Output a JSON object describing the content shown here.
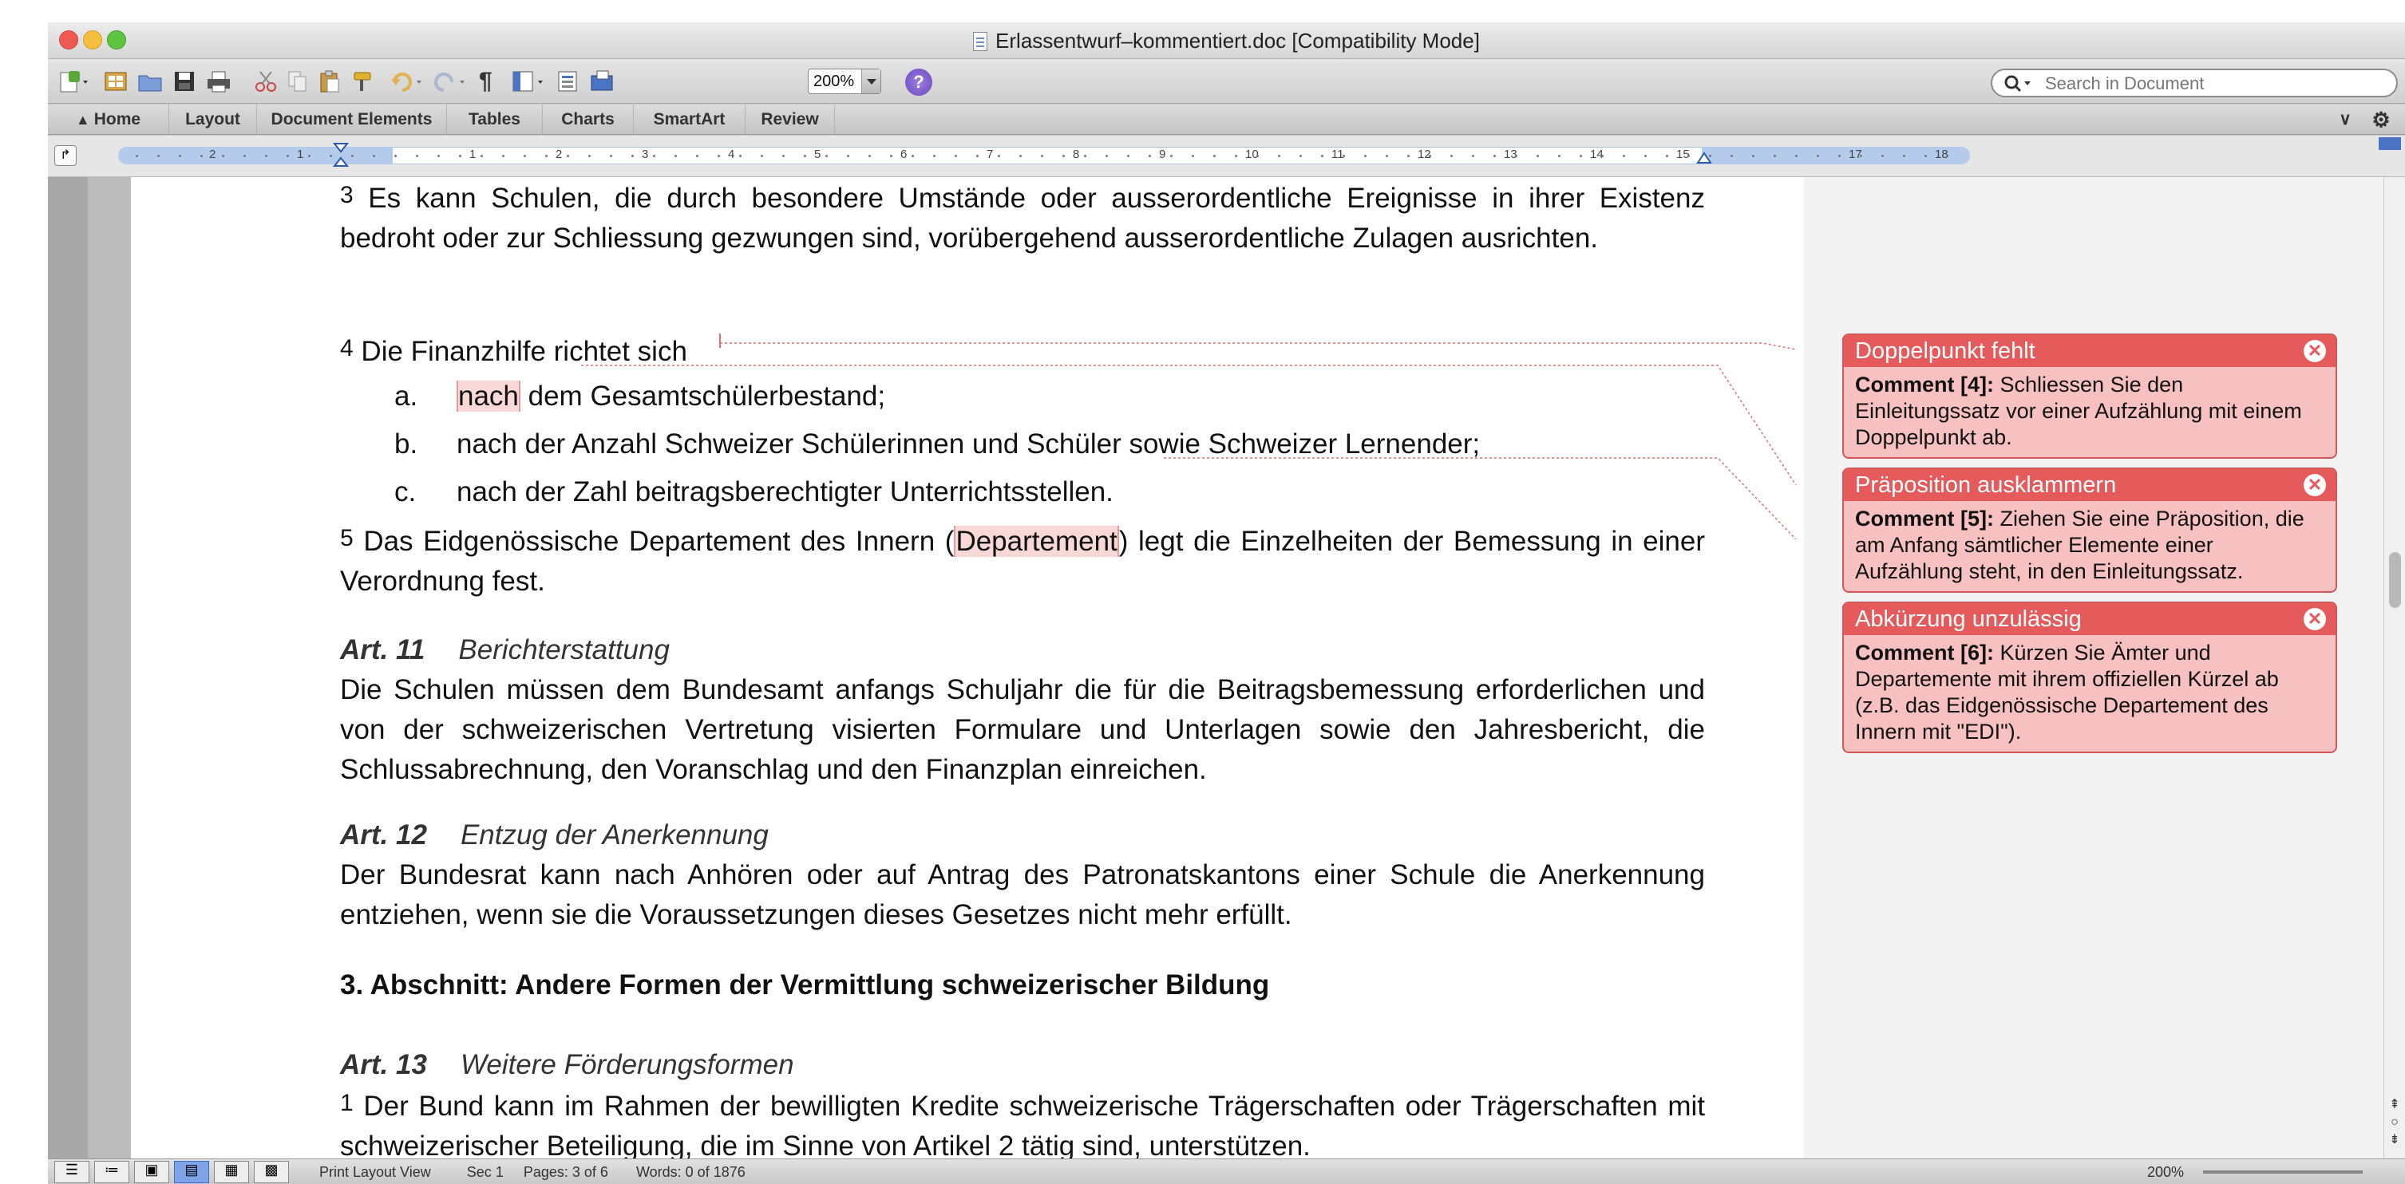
{
  "window": {
    "title": "Erlassentwurf–kommentiert.doc [Compatibility Mode]"
  },
  "toolbar": {
    "zoom": "200%",
    "help": "?",
    "search_placeholder": "Search in Document"
  },
  "ribbon": {
    "tabs": [
      "Home",
      "Layout",
      "Document Elements",
      "Tables",
      "Charts",
      "SmartArt",
      "Review"
    ]
  },
  "ruler": {
    "labels": [
      "2",
      "1",
      "1",
      "2",
      "3",
      "4",
      "5",
      "6",
      "7",
      "8",
      "9",
      "10",
      "11",
      "12",
      "13",
      "14",
      "15",
      "17",
      "18"
    ]
  },
  "document": {
    "p3_num": "3",
    "p3_text": "Es kann Schulen, die durch besondere Umstände oder ausserordentliche Ereignisse in ihrer Existenz bedroht oder zur Schliessung gezwungen sind, vorübergehend ausserordentliche Zulagen ausrichten.",
    "p4_num": "4",
    "p4_text": "Die Finanzhilfe richtet sich",
    "list": [
      {
        "marker": "a.",
        "hl": "nach",
        "text": " dem Gesamtschülerbestand;"
      },
      {
        "marker": "b.",
        "text": "nach der Anzahl Schweizer Schülerinnen und Schüler sowie Schweizer Lernender;"
      },
      {
        "marker": "c.",
        "text": "nach der Zahl beitragsberechtigter Unterrichtsstellen."
      }
    ],
    "p5_num": "5",
    "p5_pre": "Das Eidgenössische Departement des Innern (",
    "p5_hl": "Departement",
    "p5_post": ") legt die Einzelheiten der Bemessung in einer Verordnung fest.",
    "art11_num": "Art. 11",
    "art11_title": "Berichterstattung",
    "art11_text": "Die Schulen müssen dem Bundesamt anfangs Schuljahr die für die Beitragsbemessung erforderlichen und von der schweizerischen Vertretung visierten Formulare und Unterlagen sowie den Jahresbericht, die Schlussabrechnung, den Voranschlag und den Finanzplan einreichen.",
    "art12_num": "Art. 12",
    "art12_title": "Entzug der Anerkennung",
    "art12_text": "Der Bundesrat kann nach Anhören oder auf Antrag des Patronatskantons einer Schule die Anerkennung entziehen, wenn sie die Voraussetzungen dieses Gesetzes nicht mehr erfüllt.",
    "section3": "3. Abschnitt: Andere Formen der Vermittlung schweizerischer Bildung",
    "art13_num": "Art. 13",
    "art13_title": "Weitere Förderungsformen",
    "art13_p1_num": "1",
    "art13_p1_text": "Der Bund kann im Rahmen der bewilligten Kredite schweizerische Trägerschaften oder Trägerschaften mit schweizerischer Beteiligung, die im Sinne von Artikel 2 tätig sind, unterstützen."
  },
  "comments": [
    {
      "title": "Doppelpunkt fehlt",
      "label": "Comment [4]:",
      "text": " Schliessen Sie den Einleitungssatz vor einer Aufzählung mit einem Doppelpunkt ab."
    },
    {
      "title": "Präposition ausklammern",
      "label": "Comment [5]:",
      "text": " Ziehen Sie eine Präposition, die am Anfang sämtlicher Elemente einer Aufzählung steht, in den Einleitungssatz."
    },
    {
      "title": "Abkürzung unzulässig",
      "label": "Comment [6]:",
      "text": " Kürzen Sie Ämter und Departemente mit ihrem offiziellen Kürzel ab (z.B. das Eidgenössische Departement des Innern mit \"EDI\")."
    }
  ],
  "statusbar": {
    "view": "Print Layout View",
    "sec_label": "Sec",
    "sec": "1",
    "pages_label": "Pages:",
    "pages": "3 of 6",
    "words_label": "Words:",
    "words": "0 of 1876",
    "zoom": "200%"
  },
  "colors": {
    "comment_header": "#e55a5a",
    "comment_body": "#f7c1c1",
    "highlight": "#f9d8d8",
    "ruler_blue": "#b4cbeb"
  }
}
